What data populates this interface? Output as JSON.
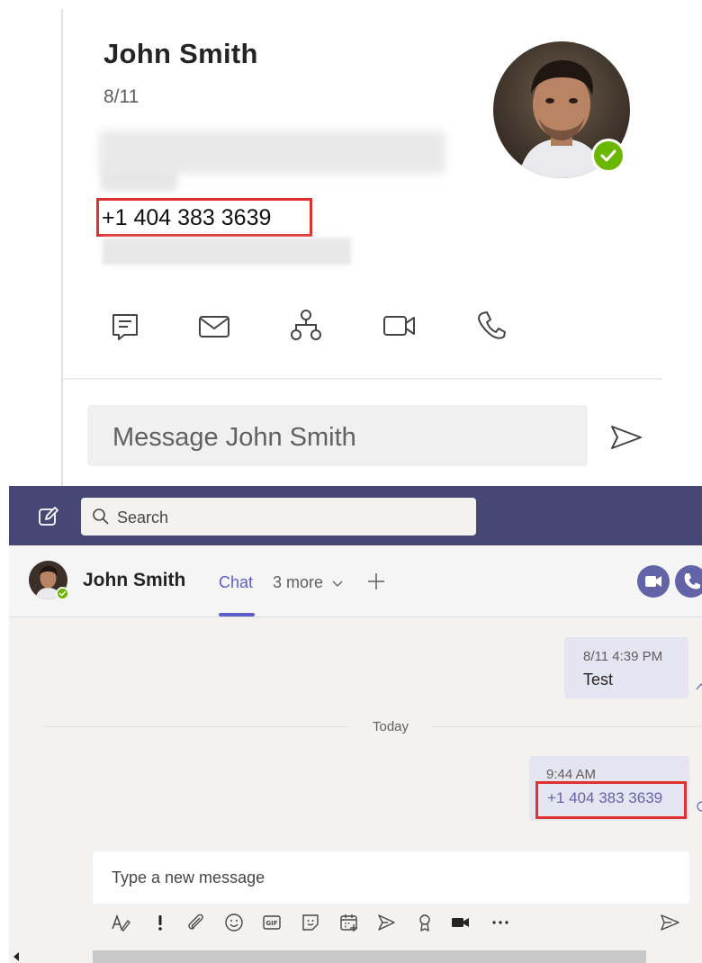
{
  "contact_card": {
    "name": "John Smith",
    "date": "8/11",
    "phone": "+1 404 383 3639",
    "presence": "available",
    "actions": [
      {
        "icon": "chat-icon"
      },
      {
        "icon": "mail-icon"
      },
      {
        "icon": "org-chart-icon"
      },
      {
        "icon": "video-call-icon"
      },
      {
        "icon": "phone-icon"
      }
    ],
    "message_placeholder": "Message John Smith"
  },
  "teams": {
    "search_placeholder": "Search",
    "header": {
      "name": "John Smith",
      "tab_active": "Chat",
      "tab_more": "3 more"
    },
    "messages": [
      {
        "time": "8/11 4:39 PM",
        "text": "Test"
      },
      {
        "time": "9:44 AM",
        "text": "+1 404 383 3639"
      }
    ],
    "divider_label": "Today",
    "composer_placeholder": "Type a new message"
  },
  "colors": {
    "titlebar": "#464775",
    "accent": "#5b5fc7",
    "link": "#6264a7",
    "highlight_box": "#e03131",
    "presence_available": "#6bb700",
    "sent_bubble": "#e5e5f1"
  }
}
